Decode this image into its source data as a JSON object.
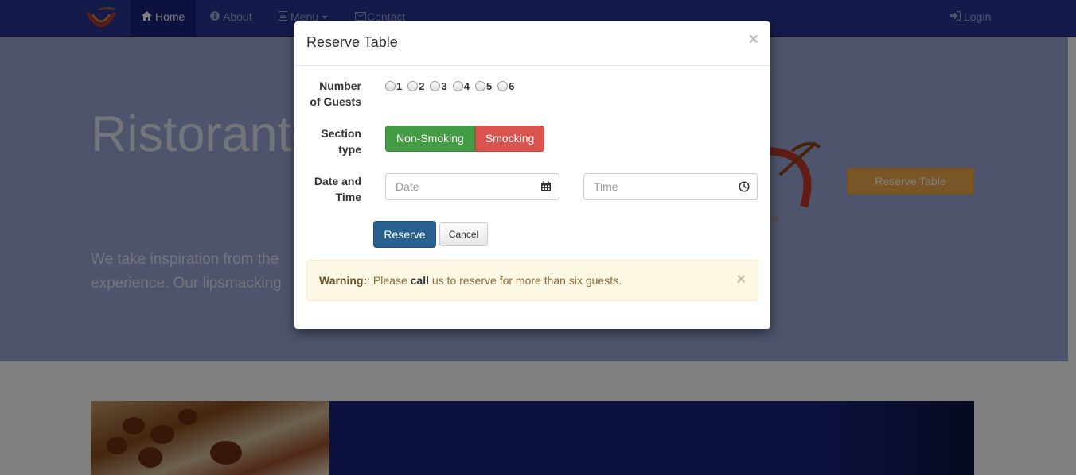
{
  "navbar": {
    "items": [
      {
        "label": "Home",
        "icon": "home-icon"
      },
      {
        "label": "About",
        "icon": "info-icon"
      },
      {
        "label": "Menu",
        "icon": "list-icon"
      },
      {
        "label": "Contact",
        "icon": "envelope-icon"
      }
    ],
    "login": {
      "label": "Login",
      "icon": "login-icon"
    }
  },
  "hero": {
    "title": "Ristorante",
    "text_line1": "We take inspiration from the",
    "text_line2": "experience. Our lipsmacking",
    "button": "Reserve Table"
  },
  "modal": {
    "title": "Reserve Table",
    "close": "×",
    "guests": {
      "label_line1": "Number",
      "label_line2": "of Guests",
      "options": [
        "1",
        "2",
        "3",
        "4",
        "5",
        "6"
      ]
    },
    "section": {
      "label_line1": "Section",
      "label_line2": "type",
      "non_smoking": "Non-Smoking",
      "smoking": "Smocking"
    },
    "datetime": {
      "label_line1": "Date and",
      "label_line2": "Time",
      "date_placeholder": "Date",
      "time_placeholder": "Time"
    },
    "reserve_button": "Reserve",
    "cancel_button": "Cancel",
    "alert": {
      "prefix": "Warning:",
      "text_before": ": Please ",
      "emphasis": "call",
      "text_after": " us to reserve for more than six guests.",
      "close": "×"
    }
  },
  "colors": {
    "navbar": "#283593",
    "jumbotron": "#9fa8da",
    "success": "#449d44",
    "danger": "#d9534f",
    "primary": "#286090",
    "warning": "#f0ad4e"
  }
}
